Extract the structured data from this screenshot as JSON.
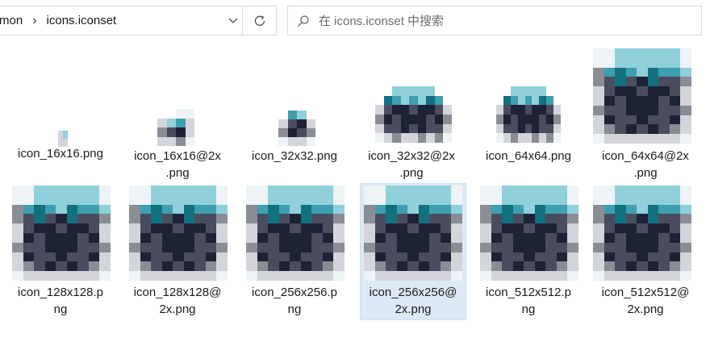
{
  "address_bar": {
    "crumbs": [
      "mon",
      "icons.iconset"
    ],
    "separator": "›"
  },
  "search": {
    "placeholder": "在 icons.iconset 中搜索"
  },
  "files": [
    {
      "name_line1": "icon_16x16.png",
      "name_line2": ""
    },
    {
      "name_line1": "icon_16x16@2x",
      "name_line2": ".png"
    },
    {
      "name_line1": "icon_32x32.png",
      "name_line2": ""
    },
    {
      "name_line1": "icon_32x32@2x",
      "name_line2": ".png"
    },
    {
      "name_line1": "icon_64x64.png",
      "name_line2": ""
    },
    {
      "name_line1": "icon_64x64@2x",
      "name_line2": ".png"
    },
    {
      "name_line1": "icon_128x128.p",
      "name_line2": "ng"
    },
    {
      "name_line1": "icon_128x128@",
      "name_line2": "2x.png"
    },
    {
      "name_line1": "icon_256x256.p",
      "name_line2": "ng"
    },
    {
      "name_line1": "icon_256x256@",
      "name_line2": "2x.png"
    },
    {
      "name_line1": "icon_512x512.p",
      "name_line2": "ng"
    },
    {
      "name_line1": "icon_512x512@",
      "name_line2": "2x.png"
    }
  ],
  "selected_file": "icon_256x256@2x.png",
  "colors": {
    "teal_light": "#8fd0da",
    "teal": "#3d9fb0",
    "teal_dark": "#13717f",
    "navy": "#1d2236",
    "slate": "#4a4d5e",
    "grey": "#8a8c96",
    "light": "#d3d5db",
    "selection": "#dde9f6"
  }
}
